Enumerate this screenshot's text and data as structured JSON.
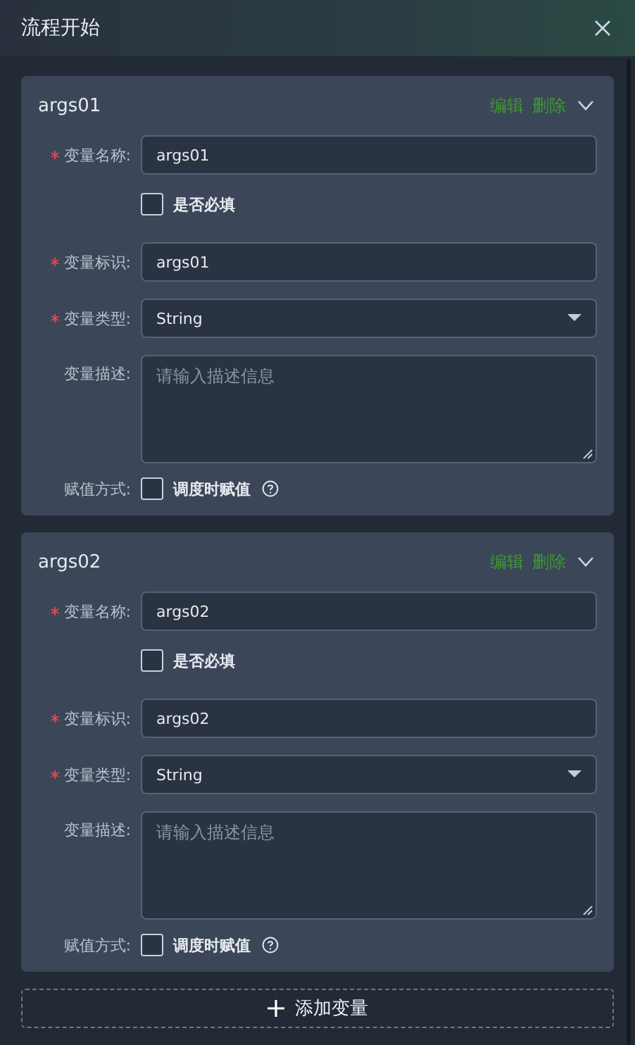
{
  "dialog": {
    "title": "流程开始"
  },
  "variables": [
    {
      "name": "args01",
      "edit": "编辑",
      "delete": "删除",
      "expanded": true,
      "rows": [
        {
          "kind": "input",
          "label": "变量名称:",
          "required": true,
          "value": "args01"
        },
        {
          "kind": "checkbox",
          "label": "是否必填",
          "checked": false
        },
        {
          "kind": "input",
          "label": "变量标识:",
          "required": true,
          "value": "args01"
        },
        {
          "kind": "select",
          "label": "变量类型:",
          "required": true,
          "value": "String"
        },
        {
          "kind": "textarea",
          "label": "变量描述:",
          "required": false,
          "placeholder": "请输入描述信息"
        },
        {
          "kind": "assign",
          "label": "赋值方式:",
          "option": "调度时赋值",
          "checked": false
        }
      ]
    },
    {
      "name": "args02",
      "edit": "编辑",
      "delete": "删除",
      "expanded": true,
      "rows": [
        {
          "kind": "input",
          "label": "变量名称:",
          "required": true,
          "value": "args02"
        },
        {
          "kind": "checkbox",
          "label": "是否必填",
          "checked": false
        },
        {
          "kind": "input",
          "label": "变量标识:",
          "required": true,
          "value": "args02"
        },
        {
          "kind": "select",
          "label": "变量类型:",
          "required": true,
          "value": "String"
        },
        {
          "kind": "textarea",
          "label": "变量描述:",
          "required": false,
          "placeholder": "请输入描述信息"
        },
        {
          "kind": "assign",
          "label": "赋值方式:",
          "option": "调度时赋值",
          "checked": false
        }
      ]
    }
  ],
  "add_button": {
    "label": "添加变量"
  }
}
